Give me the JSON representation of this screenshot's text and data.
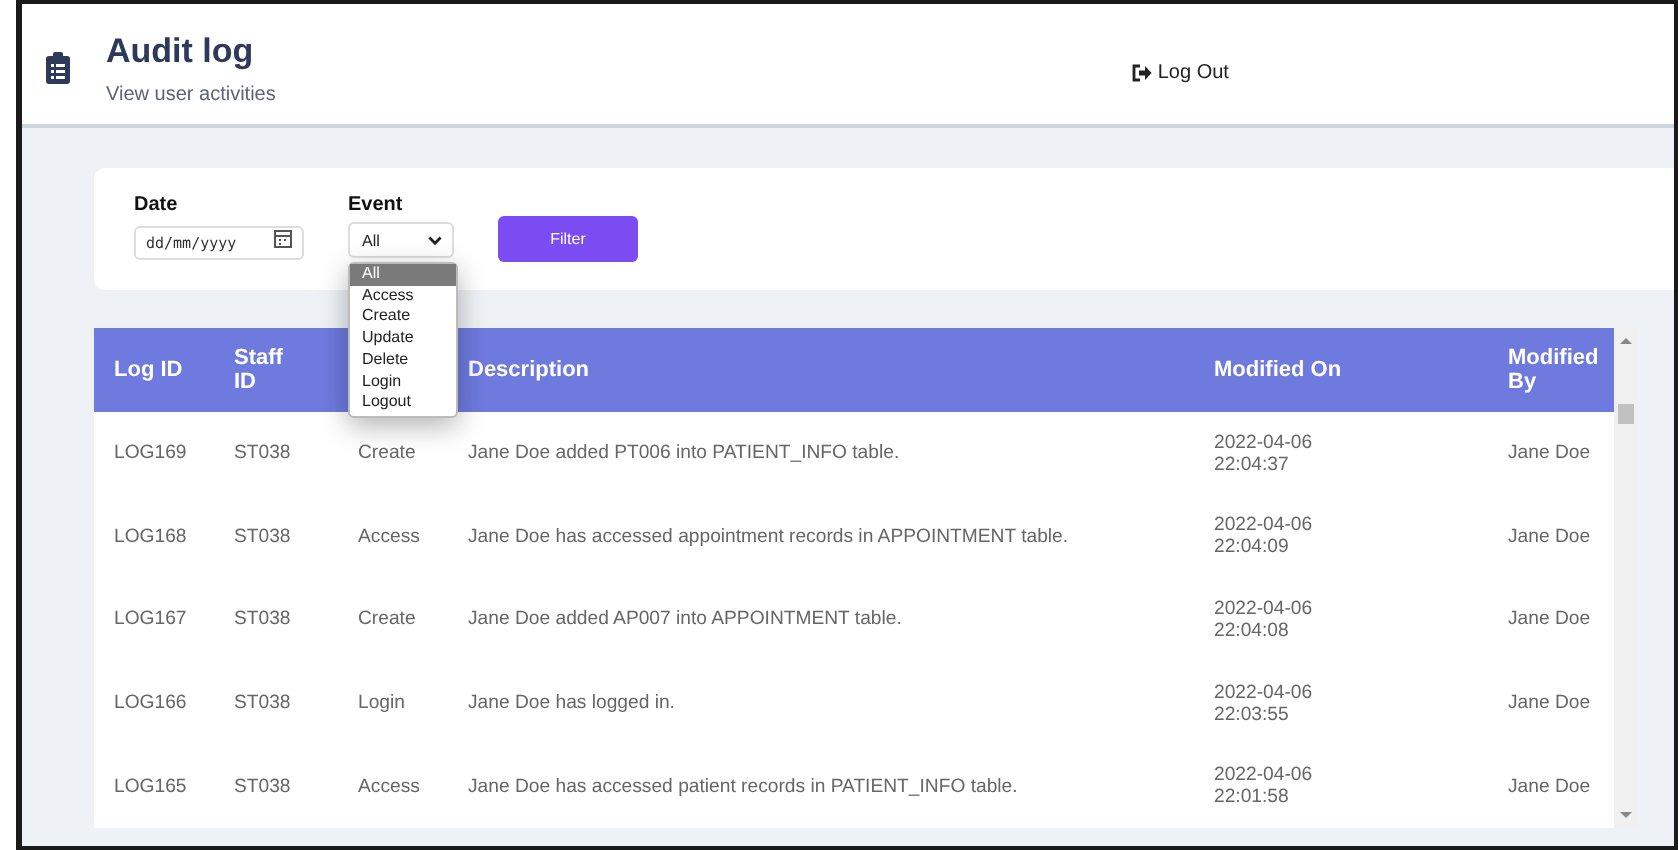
{
  "header": {
    "title": "Audit log",
    "subtitle": "View user activities",
    "logout": "Log Out"
  },
  "filter": {
    "date_label": "Date",
    "date_placeholder": "dd/mm/yyyy",
    "event_label": "Event",
    "event_value": "All",
    "button": "Filter",
    "options": [
      {
        "label": "All",
        "selected": true
      },
      {
        "label": "Access",
        "selected": false
      },
      {
        "label": "Create",
        "selected": false
      },
      {
        "label": "Update",
        "selected": false
      },
      {
        "label": "Delete",
        "selected": false
      },
      {
        "label": "Login",
        "selected": false
      },
      {
        "label": "Logout",
        "selected": false
      }
    ]
  },
  "table": {
    "columns": [
      {
        "label": "Log ID"
      },
      {
        "label": "Staff ID"
      },
      {},
      {
        "label": "Description"
      },
      {
        "label": "Modified On"
      },
      {
        "label": "Modified By"
      }
    ],
    "rows": [
      [
        "LOG169",
        "ST038",
        "Create",
        "Jane Doe added PT006 into PATIENT_INFO table.",
        "2022-04-06 22:04:37",
        "Jane Doe"
      ],
      [
        "LOG168",
        "ST038",
        "Access",
        "Jane Doe has accessed appointment records in APPOINTMENT table.",
        "2022-04-06 22:04:09",
        "Jane Doe"
      ],
      [
        "LOG167",
        "ST038",
        "Create",
        "Jane Doe added AP007 into APPOINTMENT table.",
        "2022-04-06 22:04:08",
        "Jane Doe"
      ],
      [
        "LOG166",
        "ST038",
        "Login",
        "Jane Doe has logged in.",
        "2022-04-06 22:03:55",
        "Jane Doe"
      ],
      [
        "LOG165",
        "ST038",
        "Access",
        "Jane Doe has accessed patient records in PATIENT_INFO table.",
        "2022-04-06 22:01:58",
        "Jane Doe"
      ]
    ]
  }
}
